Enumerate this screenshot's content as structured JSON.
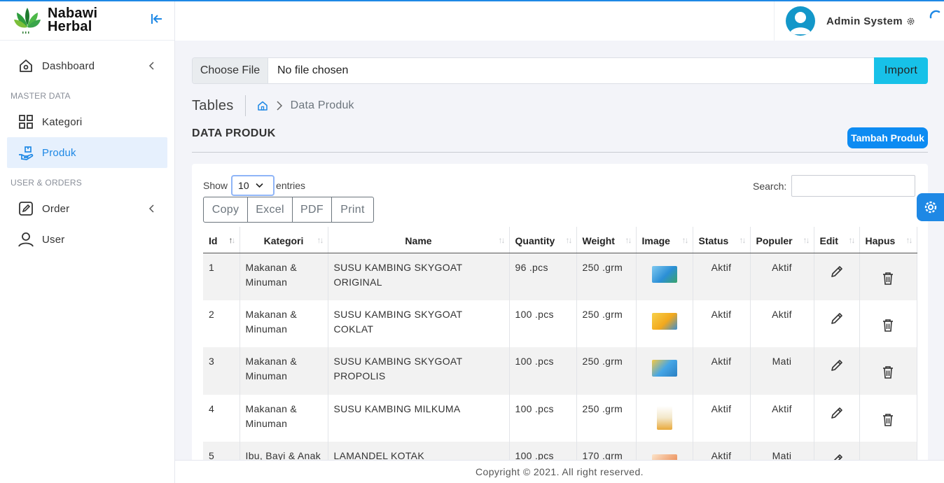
{
  "brand": {
    "line1": "Nabawi",
    "line2": "Herbal"
  },
  "header": {
    "user_name": "Admin System"
  },
  "sidebar": {
    "items": [
      {
        "label": "Dashboard",
        "icon": "home-icon",
        "has_chevron": true
      },
      {
        "section": "MASTER DATA"
      },
      {
        "label": "Kategori",
        "icon": "grid-icon"
      },
      {
        "label": "Produk",
        "icon": "product-hand-icon",
        "active": true
      },
      {
        "section": "USER & ORDERS"
      },
      {
        "label": "Order",
        "icon": "order-edit-icon",
        "has_chevron": true
      },
      {
        "label": "User",
        "icon": "user-icon"
      }
    ]
  },
  "file_input": {
    "button_label": "Choose File",
    "value": "No file chosen",
    "import_label": "Import"
  },
  "breadcrumb": {
    "title": "Tables",
    "current": "Data Produk"
  },
  "section": {
    "title": "DATA PRODUK",
    "add_button": "Tambah Produk"
  },
  "datatable": {
    "show_label": "Show",
    "length_value": "10",
    "entries_label": "entries",
    "search_label": "Search:",
    "export_buttons": [
      "Copy",
      "Excel",
      "PDF",
      "Print"
    ],
    "columns": [
      "Id",
      "Kategori",
      "Name",
      "Quantity",
      "Weight",
      "Image",
      "Status",
      "Populer",
      "Edit",
      "Hapus"
    ],
    "rows": [
      {
        "id": "1",
        "kategori": "Makanan & Minuman",
        "name": "SUSU KAMBING SKYGOAT ORIGINAL",
        "quantity": "96 .pcs",
        "weight": "250 .grm",
        "image": "product-image-blue-box",
        "status": "Aktif",
        "populer": "Aktif"
      },
      {
        "id": "2",
        "kategori": "Makanan & Minuman",
        "name": "SUSU KAMBING SKYGOAT COKLAT",
        "quantity": "100 .pcs",
        "weight": "250 .grm",
        "image": "product-image-yellow-box",
        "status": "Aktif",
        "populer": "Aktif"
      },
      {
        "id": "3",
        "kategori": "Makanan & Minuman",
        "name": "SUSU KAMBING SKYGOAT PROPOLIS",
        "quantity": "100 .pcs",
        "weight": "250 .grm",
        "image": "product-image-blue-yellow-box",
        "status": "Aktif",
        "populer": "Mati"
      },
      {
        "id": "4",
        "kategori": "Makanan & Minuman",
        "name": "SUSU KAMBING MILKUMA",
        "quantity": "100 .pcs",
        "weight": "250 .grm",
        "image": "product-image-milkuma",
        "status": "Aktif",
        "populer": "Aktif"
      },
      {
        "id": "5",
        "kategori": "Ibu, Bayi & Anak",
        "name": "LAMANDEL KOTAK",
        "quantity": "100 .pcs",
        "weight": "170 .grm",
        "image": "product-image-lamandel",
        "status": "Aktif",
        "populer": "Mati"
      }
    ]
  },
  "footer": {
    "text": "Copyright © 2021. All right reserved."
  },
  "colors": {
    "primary": "#1e88e5",
    "info": "#17c1e8",
    "active_bg": "#e6f0fd"
  }
}
